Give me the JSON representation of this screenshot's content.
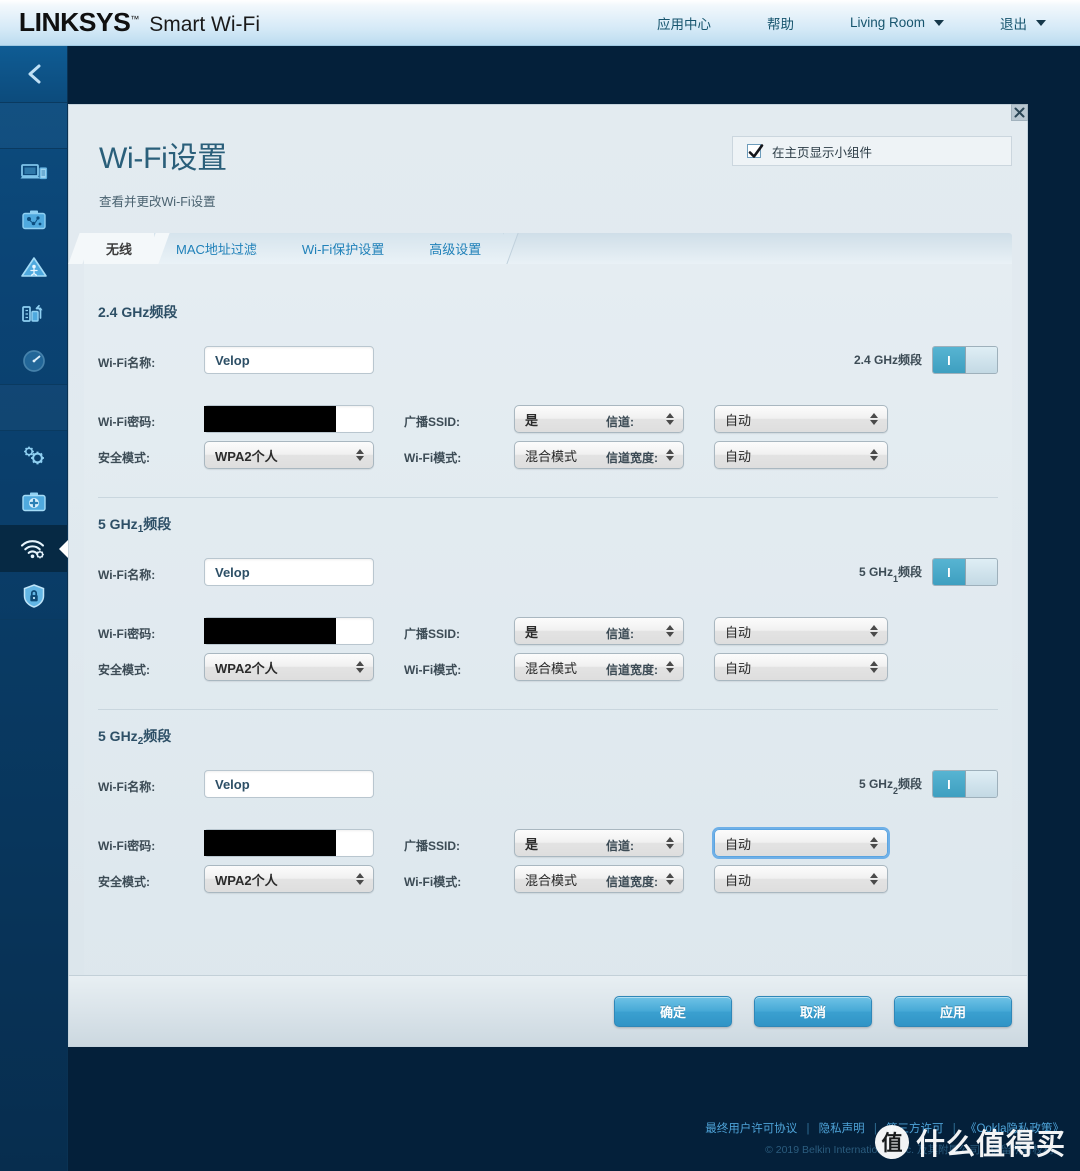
{
  "header": {
    "brand": "LINKSYS",
    "brand_tm": "™",
    "product": "Smart Wi-Fi",
    "nav": [
      {
        "label": "应用中心",
        "has_caret": false
      },
      {
        "label": "帮助",
        "has_caret": false
      },
      {
        "label": "Living Room",
        "has_caret": true
      },
      {
        "label": "退出",
        "has_caret": true
      }
    ]
  },
  "sidebar": {
    "back_icon": "chevron-left-icon",
    "items": [
      {
        "icon": "devices-icon",
        "name": "device-list"
      },
      {
        "icon": "guest-access-icon",
        "name": "guest-access"
      },
      {
        "icon": "parental-controls-icon",
        "name": "parental-controls"
      },
      {
        "icon": "media-prioritization-icon",
        "name": "media-prioritization"
      },
      {
        "icon": "speed-test-icon",
        "name": "speed-test"
      },
      {
        "icon": "connectivity-gears-icon",
        "name": "connectivity"
      },
      {
        "icon": "troubleshooting-kit-icon",
        "name": "troubleshooting"
      },
      {
        "icon": "wifi-settings-icon",
        "name": "wifi-settings",
        "active": true
      },
      {
        "icon": "security-shield-icon",
        "name": "security"
      }
    ]
  },
  "panel": {
    "title": "Wi-Fi设置",
    "subtitle": "查看并更改Wi-Fi设置",
    "close_icon": "close-icon",
    "widget_checkbox": {
      "checked": true,
      "label": "在主页显示小组件"
    },
    "tabs": [
      {
        "label": "无线",
        "active": true
      },
      {
        "label": "MAC地址过滤",
        "active": false
      },
      {
        "label": "Wi-Fi保护设置",
        "active": false
      },
      {
        "label": "高级设置",
        "active": false
      }
    ]
  },
  "labels": {
    "wifi_name": "Wi-Fi名称:",
    "wifi_password": "Wi-Fi密码:",
    "security_mode": "安全模式:",
    "broadcast_ssid": "广播SSID:",
    "wifi_mode": "Wi-Fi模式:",
    "channel": "信道:",
    "channel_width": "信道宽度:"
  },
  "bands": [
    {
      "id": "band-2g",
      "title_main": "2.4 GHz",
      "title_sub": "",
      "title_tail": "频段",
      "toggle_label_main": "2.4 GHz",
      "toggle_label_sub": "",
      "toggle_label_tail": "频段",
      "toggle_on": true,
      "toggle_on_glyph": "I",
      "wifi_name": "Velop",
      "wifi_password_redacted": true,
      "security_mode": "WPA2个人",
      "broadcast_ssid": "是",
      "wifi_mode": "混合模式",
      "channel": "自动",
      "channel_focused": false,
      "channel_width": "自动"
    },
    {
      "id": "band-5g-1",
      "title_main": "5 GHz",
      "title_sub": "1",
      "title_tail": "频段",
      "toggle_label_main": "5 GHz",
      "toggle_label_sub": "1",
      "toggle_label_tail": "频段",
      "toggle_on": true,
      "toggle_on_glyph": "I",
      "wifi_name": "Velop",
      "wifi_password_redacted": true,
      "security_mode": "WPA2个人",
      "broadcast_ssid": "是",
      "wifi_mode": "混合模式",
      "channel": "自动",
      "channel_focused": false,
      "channel_width": "自动"
    },
    {
      "id": "band-5g-2",
      "title_main": "5 GHz",
      "title_sub": "2",
      "title_tail": "频段",
      "toggle_label_main": "5 GHz",
      "toggle_label_sub": "2",
      "toggle_label_tail": "频段",
      "toggle_on": true,
      "toggle_on_glyph": "I",
      "wifi_name": "Velop",
      "wifi_password_redacted": true,
      "security_mode": "WPA2个人",
      "broadcast_ssid": "是",
      "wifi_mode": "混合模式",
      "channel": "自动",
      "channel_focused": true,
      "channel_width": "自动"
    }
  ],
  "buttons": {
    "ok": "确定",
    "cancel": "取消",
    "apply": "应用"
  },
  "footer": {
    "links": [
      "最终用户许可协议",
      "隐私声明",
      "第三方许可",
      "《Ookla隐私政策》"
    ],
    "separator": "|",
    "copyright": "© 2019 Belkin International, Inc. 及其附属公司。保留所有权利。"
  },
  "watermark": {
    "mark": "值",
    "text": "什么值得买"
  },
  "colors": {
    "brand_blue": "#0c4e80",
    "accent": "#45a8d6",
    "panel_bg": "#e3ebf0",
    "page_bg": "#04203a",
    "tab_link": "#2081b9"
  }
}
